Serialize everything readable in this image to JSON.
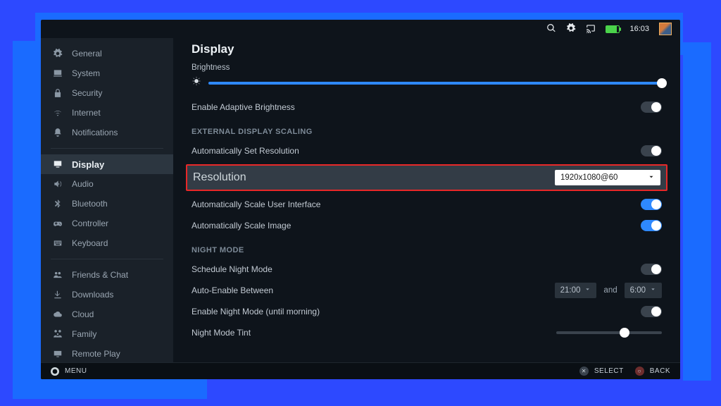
{
  "status": {
    "time": "16:03"
  },
  "sidebar": {
    "items": [
      {
        "label": "General"
      },
      {
        "label": "System"
      },
      {
        "label": "Security"
      },
      {
        "label": "Internet"
      },
      {
        "label": "Notifications"
      },
      {
        "label": "Display"
      },
      {
        "label": "Audio"
      },
      {
        "label": "Bluetooth"
      },
      {
        "label": "Controller"
      },
      {
        "label": "Keyboard"
      },
      {
        "label": "Friends & Chat"
      },
      {
        "label": "Downloads"
      },
      {
        "label": "Cloud"
      },
      {
        "label": "Family"
      },
      {
        "label": "Remote Play"
      }
    ]
  },
  "display": {
    "title": "Display",
    "brightness_label": "Brightness",
    "adaptive_brightness_label": "Enable Adaptive Brightness",
    "ext_section": "EXTERNAL DISPLAY SCALING",
    "auto_res_label": "Automatically Set Resolution",
    "resolution_label": "Resolution",
    "resolution_value": "1920x1080@60",
    "auto_ui_label": "Automatically Scale User Interface",
    "auto_img_label": "Automatically Scale Image",
    "night_section": "NIGHT MODE",
    "schedule_label": "Schedule Night Mode",
    "auto_enable_label": "Auto-Enable Between",
    "time_from": "21:00",
    "time_and": "and",
    "time_to": "6:00",
    "enable_night_label": "Enable Night Mode (until morning)",
    "tint_label": "Night Mode Tint"
  },
  "footer": {
    "menu": "MENU",
    "select": "SELECT",
    "back": "BACK"
  }
}
